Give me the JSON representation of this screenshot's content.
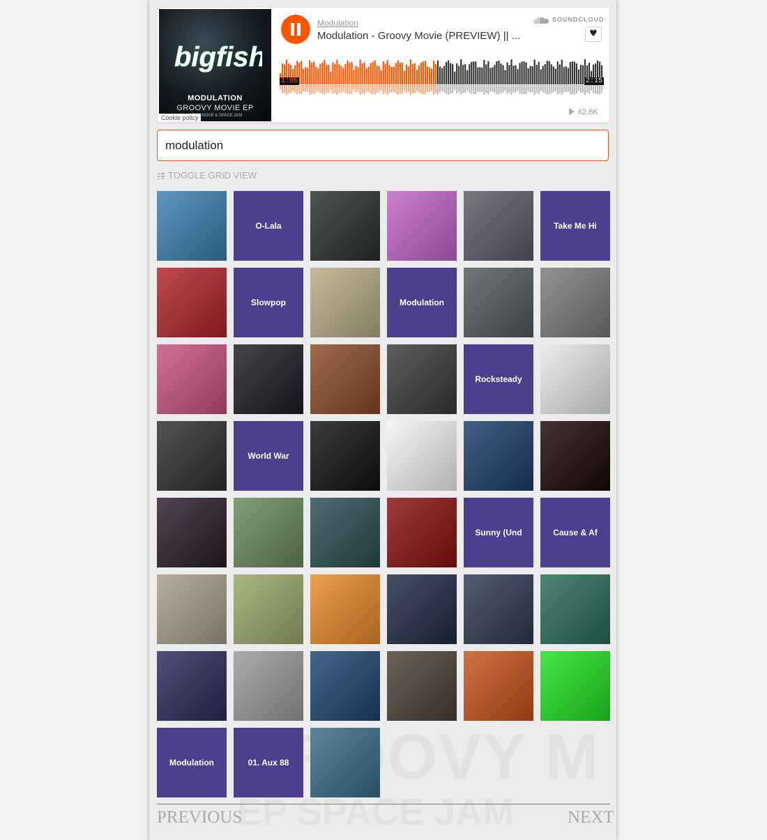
{
  "player": {
    "artwork": {
      "logo_text": "bigfish",
      "title": "MODULATION",
      "subtitle": "GROOVY MOVIE EP",
      "subtitle2": "...OVY MOVE & SPACE JAM"
    },
    "cookie_policy": "Cookie policy",
    "artist": "Modulation",
    "title": "Modulation - Groovy Movie (PREVIEW) || ...",
    "brand": "SOUNDCLOUD",
    "time_elapsed": "1:06",
    "time_total": "2:15",
    "progress": 0.49,
    "play_count": "62.6K",
    "accent_color": "#ff5500"
  },
  "search": {
    "value": "modulation"
  },
  "toggle_label": "TOGGLE GRID VIEW",
  "tiles": [
    {
      "name": "tile-portrait-headphones",
      "label": "",
      "bg": "#3a7fb0"
    },
    {
      "name": "tile-o-lala",
      "label": "O-Lala",
      "bg": "#4b3f8e"
    },
    {
      "name": "tile-portrait-man",
      "label": "",
      "bg": "#2a2f2c"
    },
    {
      "name": "tile-abstract-pink",
      "label": "",
      "bg": "#c264c8"
    },
    {
      "name": "tile-abstract-colorful",
      "label": "",
      "bg": "#5c5a68"
    },
    {
      "name": "tile-take-me-hi",
      "label": "Take Me Hi",
      "bg": "#4b3f8e"
    },
    {
      "name": "tile-afro-art",
      "label": "",
      "bg": "#b0232a"
    },
    {
      "name": "tile-slowpop",
      "label": "Slowpop",
      "bg": "#4b3f8e"
    },
    {
      "name": "tile-fabric-art",
      "label": "",
      "bg": "#b8ad86"
    },
    {
      "name": "tile-modulation-1",
      "label": "Modulation",
      "bg": "#4b3f8e"
    },
    {
      "name": "tile-man-suit",
      "label": "",
      "bg": "#55595d"
    },
    {
      "name": "tile-model-style",
      "label": "",
      "bg": "#7a7a7a"
    },
    {
      "name": "tile-tunnel-colors",
      "label": "",
      "bg": "#c8517e"
    },
    {
      "name": "tile-man-white-tshirt",
      "label": "",
      "bg": "#1c1c22"
    },
    {
      "name": "tile-indian-rhythm",
      "label": "",
      "bg": "#8a4a28"
    },
    {
      "name": "tile-synth-knobs",
      "label": "",
      "bg": "#3a3a3a"
    },
    {
      "name": "tile-rocksteady",
      "label": "Rocksteady",
      "bg": "#4b3f8e"
    },
    {
      "name": "tile-wilkinson",
      "label": "",
      "bg": "#e8e8e8"
    },
    {
      "name": "tile-man-cap",
      "label": "",
      "bg": "#2e2e2e"
    },
    {
      "name": "tile-world-war",
      "label": "World War",
      "bg": "#4b3f8e"
    },
    {
      "name": "tile-grid-pattern",
      "label": "",
      "bg": "#111111"
    },
    {
      "name": "tile-waveforms",
      "label": "",
      "bg": "#f4f4f4"
    },
    {
      "name": "tile-space-light",
      "label": "",
      "bg": "#1b3d6a"
    },
    {
      "name": "tile-comet",
      "label": "",
      "bg": "#190805"
    },
    {
      "name": "tile-man-hat",
      "label": "",
      "bg": "#2a1c2a"
    },
    {
      "name": "tile-old-man-child",
      "label": "",
      "bg": "#6a8a5c"
    },
    {
      "name": "tile-forest-path",
      "label": "",
      "bg": "#2a4d52"
    },
    {
      "name": "tile-red-face",
      "label": "",
      "bg": "#8a1010"
    },
    {
      "name": "tile-sunny-und",
      "label": "Sunny (Und",
      "bg": "#4b3f8e"
    },
    {
      "name": "tile-cause-af",
      "label": "Cause & Af",
      "bg": "#4b3f8e"
    },
    {
      "name": "tile-cubes-city",
      "label": "",
      "bg": "#a89d8c"
    },
    {
      "name": "tile-cpu-chip",
      "label": "",
      "bg": "#9aa86a"
    },
    {
      "name": "tile-orange-pedal",
      "label": "",
      "bg": "#e88a2a"
    },
    {
      "name": "tile-astronaut",
      "label": "",
      "bg": "#1e2a44"
    },
    {
      "name": "tile-space-shuttle",
      "label": "",
      "bg": "#2e3a52"
    },
    {
      "name": "tile-psychedelic",
      "label": "",
      "bg": "#2a6a5a"
    },
    {
      "name": "tile-mandala",
      "label": "",
      "bg": "#2a2a5c"
    },
    {
      "name": "tile-vinyl-turntable",
      "label": "",
      "bg": "#9a9a9a"
    },
    {
      "name": "tile-polaris",
      "label": "",
      "bg": "#1d4470"
    },
    {
      "name": "tile-modular-synth",
      "label": "",
      "bg": "#4a4038"
    },
    {
      "name": "tile-tree-art",
      "label": "",
      "bg": "#c8521a"
    },
    {
      "name": "tile-green-noise",
      "label": "",
      "bg": "#20e020"
    },
    {
      "name": "tile-modulation-2",
      "label": "Modulation",
      "bg": "#4b3f8e"
    },
    {
      "name": "tile-aux-88",
      "label": "01. Aux 88",
      "bg": "#4b3f8e"
    },
    {
      "name": "tile-slangor",
      "label": "",
      "bg": "#3a6a88"
    }
  ],
  "pager": {
    "previous": "PREVIOUS",
    "next": "NEXT"
  }
}
